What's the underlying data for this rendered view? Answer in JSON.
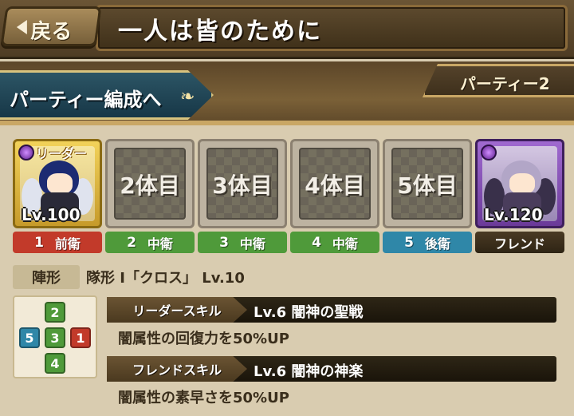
{
  "header": {
    "back_label": "戻る",
    "title": "一人は皆のために"
  },
  "party": {
    "edit_button_label": "パーティー編成へ",
    "party_name": "パーティー2"
  },
  "members": [
    {
      "type": "leader",
      "tag": "リーダー",
      "level": "Lv.100",
      "position_num": "1",
      "position": "前衛",
      "position_color": "#c23a2a"
    },
    {
      "type": "empty",
      "slot_label": "2体目",
      "position_num": "2",
      "position": "中衛",
      "position_color": "#4f9a3a"
    },
    {
      "type": "empty",
      "slot_label": "3体目",
      "position_num": "3",
      "position": "中衛",
      "position_color": "#4f9a3a"
    },
    {
      "type": "empty",
      "slot_label": "4体目",
      "position_num": "4",
      "position": "中衛",
      "position_color": "#4f9a3a"
    },
    {
      "type": "empty",
      "slot_label": "5体目",
      "position_num": "5",
      "position": "後衛",
      "position_color": "#2f87a8"
    },
    {
      "type": "friend",
      "level": "Lv.120",
      "label": "フレンド"
    }
  ],
  "formation": {
    "tag": "陣形",
    "text": "隊形 I「クロス」 Lv.10",
    "grid": {
      "top": "2",
      "left": "5",
      "center": "3",
      "right": "1",
      "bottom": "4"
    }
  },
  "skills": {
    "leader": {
      "tag": "リーダースキル",
      "name": "Lv.6 闇神の聖戦",
      "description": "闇属性の回復力を50%UP"
    },
    "friend": {
      "tag": "フレンドスキル",
      "name": "Lv.6 闇神の神楽",
      "description": "闇属性の素早さを50%UP"
    }
  }
}
